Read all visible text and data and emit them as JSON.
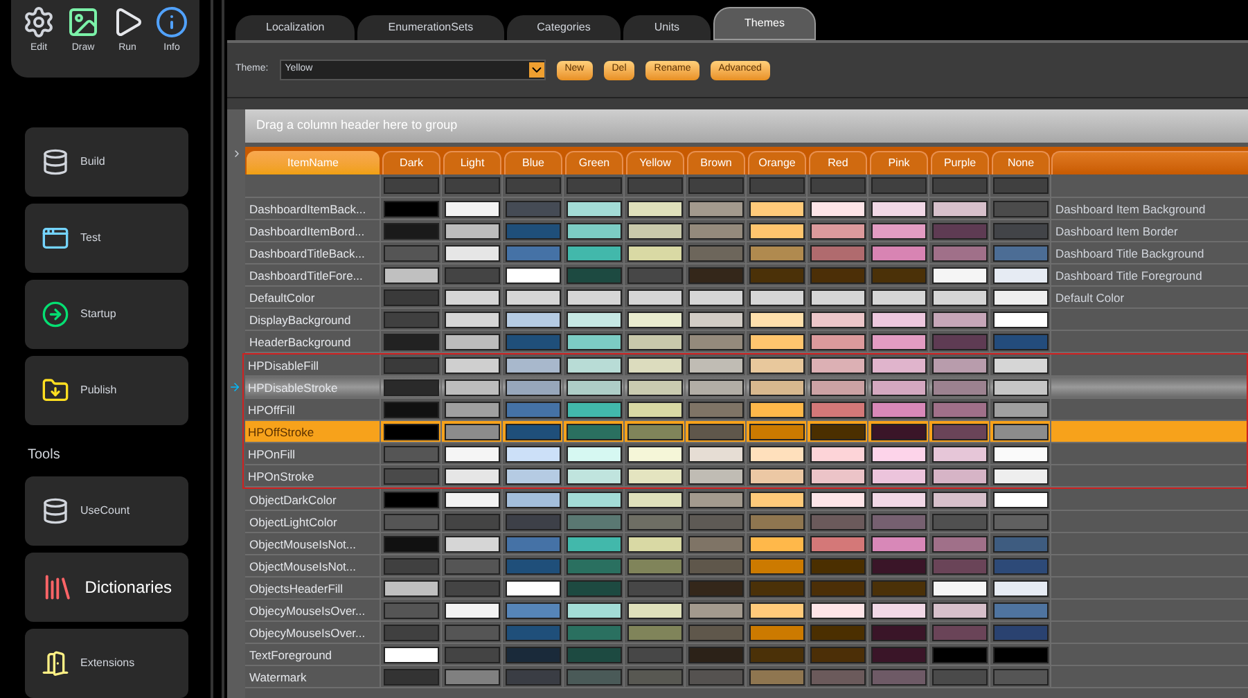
{
  "toolbar": [
    {
      "label": "Edit",
      "kind": "gear"
    },
    {
      "label": "Draw",
      "kind": "picture"
    },
    {
      "label": "Run",
      "kind": "play"
    },
    {
      "label": "Info",
      "kind": "info"
    }
  ],
  "sidebar": {
    "items": [
      {
        "label": "Build",
        "kind": "database",
        "large": false
      },
      {
        "label": "Test",
        "kind": "window",
        "large": false
      },
      {
        "label": "Startup",
        "kind": "arrow",
        "large": false
      },
      {
        "label": "Publish",
        "kind": "folder",
        "large": false
      }
    ],
    "section_title": "Tools",
    "tools": [
      {
        "label": "UseCount",
        "kind": "database",
        "large": false
      },
      {
        "label": "Dictionaries",
        "kind": "books",
        "large": true
      },
      {
        "label": "Extensions",
        "kind": "door",
        "large": false
      }
    ]
  },
  "tabs": [
    {
      "label": "Localization",
      "selected": false
    },
    {
      "label": "EnumerationSets",
      "selected": false
    },
    {
      "label": "Categories",
      "selected": false
    },
    {
      "label": "Units",
      "selected": false
    },
    {
      "label": "Themes",
      "selected": true
    }
  ],
  "theme_bar": {
    "label": "Theme:",
    "value": "Yellow",
    "buttons": [
      "New",
      "Del",
      "Rename",
      "Advanced"
    ]
  },
  "group_hint": "Drag a column header here to group",
  "table": {
    "columns": [
      "ItemName",
      "Dark",
      "Light",
      "Blue",
      "Green",
      "Yellow",
      "Brown",
      "Orange",
      "Red",
      "Pink",
      "Purple",
      "None"
    ],
    "rows": [
      {
        "name": "DashboardItemBack...",
        "description": "Dashboard Item Background",
        "selected": false,
        "hovered": false,
        "framed": false,
        "swatches": [
          {
            "color": "#000000"
          },
          {
            "color": "#f2f2f2"
          },
          {
            "color": "#454b55"
          },
          {
            "color": "#a3dcd6"
          },
          {
            "color": "#dfe0bb"
          },
          {
            "color": "#a39a8e"
          },
          {
            "color": "#ffca7a"
          },
          {
            "color": "#fde4e7"
          },
          {
            "color": "#f1d8e6"
          },
          {
            "color": "#d7c0cb"
          },
          {
            "color": "#4b4b4b"
          }
        ]
      },
      {
        "name": "DashboardItemBord...",
        "description": "Dashboard Item Border",
        "selected": false,
        "hovered": false,
        "framed": false,
        "swatches": [
          {
            "color": "#1a1a1a"
          },
          {
            "color": "#bdbdbd"
          },
          {
            "color": "#1f4f7a"
          },
          {
            "color": "#7cccc4"
          },
          {
            "color": "#c9c9ab"
          },
          {
            "color": "#948a7c"
          },
          {
            "color": "#ffc56e"
          },
          {
            "color": "#dc9a9c"
          },
          {
            "color": "#e39cc3"
          },
          {
            "color": "#5e3b53"
          },
          {
            "color": "#424448"
          }
        ]
      },
      {
        "name": "DashboardTitleBack...",
        "description": "Dashboard Title Background",
        "selected": false,
        "hovered": false,
        "framed": false,
        "swatches": [
          {
            "color": "#555555"
          },
          {
            "color": "#e6e6e6"
          },
          {
            "color": "#4572a6"
          },
          {
            "color": "#42b8ab"
          },
          {
            "color": "#d9d9a4"
          },
          {
            "color": "#6d665b"
          },
          {
            "color": "#b08a4f"
          },
          {
            "color": "#b06b6e"
          },
          {
            "color": "#d884b3"
          },
          {
            "color": "#a07089"
          },
          {
            "color": "#4c6d95"
          }
        ]
      },
      {
        "name": "DashboardTitleFore...",
        "description": "Dashboard Title Foreground",
        "selected": false,
        "hovered": false,
        "framed": false,
        "swatches": [
          {
            "color": "#c0c0c0"
          },
          {
            "color": "#444444"
          },
          {
            "color": "#ffffff"
          },
          {
            "color": "#1d4a41"
          },
          {
            "color": "#474747"
          },
          {
            "color": "#34271a"
          },
          {
            "color": "#4b3108"
          },
          {
            "color": "#4c2f07"
          },
          {
            "color": "#4b3108"
          },
          {
            "color": "#f5f5f5"
          },
          {
            "color": "#e6ebf3"
          }
        ]
      },
      {
        "name": "DefaultColor",
        "description": "Default Color",
        "selected": false,
        "hovered": false,
        "framed": false,
        "swatches": [
          {
            "color": "#3a3a3a"
          },
          {
            "color": "#d6d6d6"
          },
          {
            "color": "#d6d6d6"
          },
          {
            "color": "#d6d6d6"
          },
          {
            "color": "#d6d6d6"
          },
          {
            "color": "#d6d6d6"
          },
          {
            "color": "#d6d6d6"
          },
          {
            "color": "#d6d6d6"
          },
          {
            "color": "#d6d6d6"
          },
          {
            "color": "#d6d6d6"
          },
          {
            "color": "#eeeeee"
          }
        ]
      },
      {
        "name": "DisplayBackground",
        "selected": false,
        "hovered": false,
        "framed": false,
        "swatches": [
          {
            "color": "#404040"
          },
          {
            "color": "#d6d6d6"
          },
          {
            "color": "#b5cbe3"
          },
          {
            "color": "#c6e8e4"
          },
          {
            "color": "#eaeccf"
          },
          {
            "color": "#d2ccc5"
          },
          {
            "color": "#ffe0ac"
          },
          {
            "color": "#ecc6c9"
          },
          {
            "color": "#edc7de"
          },
          {
            "color": "#c6a6b8"
          },
          {
            "color": "#ffffff"
          }
        ]
      },
      {
        "name": "HeaderBackground",
        "selected": false,
        "hovered": false,
        "framed": false,
        "swatches": [
          {
            "color": "#222222"
          },
          {
            "color": "#bdbdbd"
          },
          {
            "color": "#1f4f7a"
          },
          {
            "color": "#7cccc4"
          },
          {
            "color": "#c9c9ab"
          },
          {
            "color": "#948a7c"
          },
          {
            "color": "#ffc56e"
          },
          {
            "color": "#dc9a9c"
          },
          {
            "color": "#e39cc3"
          },
          {
            "color": "#5e3b53"
          },
          {
            "color": "#234c7c"
          }
        ]
      },
      {
        "name": "HPDisableFill",
        "selected": false,
        "hovered": false,
        "framed": true,
        "swatches": [
          {
            "color": "#3a3a3a"
          },
          {
            "color": "#cfcfcf"
          },
          {
            "color": "#a8b8cc"
          },
          {
            "color": "#b8dcd6"
          },
          {
            "color": "#dcdcbe"
          },
          {
            "color": "#c0bcb4"
          },
          {
            "color": "#e8c89c"
          },
          {
            "color": "#dcb0b4"
          },
          {
            "color": "#e0b4cc"
          },
          {
            "color": "#b89cac"
          },
          {
            "color": "#d6d6d6"
          }
        ]
      },
      {
        "name": "HPDisableStroke",
        "selected": false,
        "hovered": true,
        "framed": true,
        "swatches": [
          {
            "color": "#2a2a2a"
          },
          {
            "color": "#bdbdbd"
          },
          {
            "color": "#97a7bb"
          },
          {
            "color": "#aecdc7"
          },
          {
            "color": "#cacbb0"
          },
          {
            "color": "#b2aea6"
          },
          {
            "color": "#d8b88e"
          },
          {
            "color": "#cca2a4"
          },
          {
            "color": "#d4a8c0"
          },
          {
            "color": "#9c8290"
          },
          {
            "color": "#c6c6c6"
          }
        ]
      },
      {
        "name": "HPOffFill",
        "selected": false,
        "hovered": false,
        "framed": true,
        "swatches": [
          {
            "color": "#111111"
          },
          {
            "color": "#a0a0a0"
          },
          {
            "color": "#4572a6"
          },
          {
            "color": "#42b8ab"
          },
          {
            "color": "#d9d9a4"
          },
          {
            "color": "#7f7466"
          },
          {
            "color": "#ffb84a"
          },
          {
            "color": "#d47878"
          },
          {
            "color": "#d888b8"
          },
          {
            "color": "#a07089"
          },
          {
            "color": "#a0a0a0"
          }
        ]
      },
      {
        "name": "HPOffStroke",
        "selected": true,
        "hovered": false,
        "framed": true,
        "swatches": [
          {
            "color": "#000000"
          },
          {
            "color": "#8c8c8c"
          },
          {
            "color": "#1f4f7a"
          },
          {
            "color": "#2a7060"
          },
          {
            "color": "#80845a"
          },
          {
            "color": "#5f574b"
          },
          {
            "color": "#cc7a00"
          },
          {
            "color": "#4b2f00"
          },
          {
            "color": "#3a1528"
          },
          {
            "color": "#6a4458"
          },
          {
            "color": "#8c8c8c"
          }
        ]
      },
      {
        "name": "HPOnFill",
        "selected": false,
        "hovered": false,
        "framed": true,
        "swatches": [
          {
            "color": "#555555"
          },
          {
            "color": "#f5f5f5"
          },
          {
            "color": "#cce0f8"
          },
          {
            "color": "#d6f8f2"
          },
          {
            "color": "#f5f6d8"
          },
          {
            "color": "#e6ddd4"
          },
          {
            "color": "#ffe0bc"
          },
          {
            "color": "#fdd4d8"
          },
          {
            "color": "#fdd4ea"
          },
          {
            "color": "#e6c6d8"
          },
          {
            "color": "#fafafa"
          }
        ]
      },
      {
        "name": "HPOnStroke",
        "selected": false,
        "hovered": false,
        "framed": true,
        "swatches": [
          {
            "color": "#4a4a4a"
          },
          {
            "color": "#e6e6e6"
          },
          {
            "color": "#b5cbe3"
          },
          {
            "color": "#c0e4de"
          },
          {
            "color": "#e4e4c0"
          },
          {
            "color": "#c0bcb4"
          },
          {
            "color": "#ecc8a4"
          },
          {
            "color": "#ecc4c8"
          },
          {
            "color": "#ecc4dc"
          },
          {
            "color": "#d6b4c6"
          },
          {
            "color": "#eeeeee"
          }
        ]
      },
      {
        "name": "ObjectDarkColor",
        "selected": false,
        "hovered": false,
        "framed": false,
        "swatches": [
          {
            "color": "#000000"
          },
          {
            "color": "#f2f2f2"
          },
          {
            "color": "#a3bedb"
          },
          {
            "color": "#a3dcd6"
          },
          {
            "color": "#dfe0bb"
          },
          {
            "color": "#a39a8e"
          },
          {
            "color": "#ffca7a"
          },
          {
            "color": "#fde4e7"
          },
          {
            "color": "#f1d8e6"
          },
          {
            "color": "#d7c0cb"
          },
          {
            "color": "#ffffff"
          }
        ]
      },
      {
        "name": "ObjectLightColor",
        "selected": false,
        "hovered": false,
        "framed": false,
        "swatches": [
          {
            "color": "#555555"
          },
          {
            "color": "#444444"
          },
          {
            "color": "#3d4048"
          },
          {
            "color": "#5a7872"
          },
          {
            "color": "#6e6e64"
          },
          {
            "color": "#5e5a55"
          },
          {
            "color": "#8f7650"
          },
          {
            "color": "#6b5a5b"
          },
          {
            "color": "#766070"
          },
          {
            "color": "#505050"
          },
          {
            "color": "#606060"
          }
        ]
      },
      {
        "name": "ObjectMouseIsNot...",
        "selected": false,
        "hovered": false,
        "framed": false,
        "swatches": [
          {
            "color": "#111111"
          },
          {
            "color": "#d6d6d6"
          },
          {
            "color": "#4572a6"
          },
          {
            "color": "#42b8ab"
          },
          {
            "color": "#d9d9a4"
          },
          {
            "color": "#7f7466"
          },
          {
            "color": "#ffb84a"
          },
          {
            "color": "#d47878"
          },
          {
            "color": "#d888b8"
          },
          {
            "color": "#a07089"
          },
          {
            "color": "#3e5c80"
          }
        ]
      },
      {
        "name": "ObjectMouseIsNot...",
        "selected": false,
        "hovered": false,
        "framed": false,
        "swatches": [
          {
            "color": "#404040"
          },
          {
            "color": "#555555"
          },
          {
            "color": "#1f4f7a"
          },
          {
            "color": "#2a7060"
          },
          {
            "color": "#80845a"
          },
          {
            "color": "#5f574b"
          },
          {
            "color": "#cc7a00"
          },
          {
            "color": "#4b2f00"
          },
          {
            "color": "#3a1528"
          },
          {
            "color": "#6a4458"
          },
          {
            "color": "#2d4a78"
          }
        ]
      },
      {
        "name": "ObjectsHeaderFill",
        "selected": false,
        "hovered": false,
        "framed": false,
        "swatches": [
          {
            "color": "#c0c0c0"
          },
          {
            "color": "#444444"
          },
          {
            "color": "#ffffff"
          },
          {
            "color": "#1d4a41"
          },
          {
            "color": "#474747"
          },
          {
            "color": "#34271a"
          },
          {
            "color": "#4b3108"
          },
          {
            "color": "#4c2f07"
          },
          {
            "color": "#4b3108"
          },
          {
            "color": "#f5f5f5"
          },
          {
            "color": "#e6ebf3"
          }
        ]
      },
      {
        "name": "ObjecyMouseIsOver...",
        "selected": false,
        "hovered": false,
        "framed": false,
        "swatches": [
          {
            "color": "#555555"
          },
          {
            "color": "#f2f2f2"
          },
          {
            "color": "#5685b8"
          },
          {
            "color": "#a3dcd6"
          },
          {
            "color": "#dfe0bb"
          },
          {
            "color": "#a39a8e"
          },
          {
            "color": "#ffca7a"
          },
          {
            "color": "#fde4e7"
          },
          {
            "color": "#f1d8e6"
          },
          {
            "color": "#d7c0cb"
          },
          {
            "color": "#4f74a0"
          }
        ]
      },
      {
        "name": "ObjecyMouseIsOver...",
        "selected": false,
        "hovered": false,
        "framed": false,
        "swatches": [
          {
            "color": "#404040"
          },
          {
            "color": "#555555"
          },
          {
            "color": "#1f4f7a"
          },
          {
            "color": "#2a7060"
          },
          {
            "color": "#80845a"
          },
          {
            "color": "#5f574b"
          },
          {
            "color": "#cc7a00"
          },
          {
            "color": "#4b2f00"
          },
          {
            "color": "#3a1528"
          },
          {
            "color": "#6a4458"
          },
          {
            "color": "#2a4270"
          }
        ]
      },
      {
        "name": "TextForeground",
        "selected": false,
        "hovered": false,
        "framed": false,
        "swatches": [
          {
            "color": "#ffffff"
          },
          {
            "color": "#444444"
          },
          {
            "color": "#1a2a3a"
          },
          {
            "color": "#1d4a41"
          },
          {
            "color": "#474747"
          },
          {
            "color": "#2c2218"
          },
          {
            "color": "#4b3108"
          },
          {
            "color": "#4c2f07"
          },
          {
            "color": "#3a1528"
          },
          {
            "color": "#000000"
          },
          {
            "color": "#000000"
          }
        ]
      },
      {
        "name": "Watermark",
        "selected": false,
        "hovered": false,
        "framed": false,
        "swatches": [
          {
            "color": "#333333"
          },
          {
            "color": "#808080"
          },
          {
            "color": "#3a3d44"
          },
          {
            "color": "#4a5a58"
          },
          {
            "color": "#585852"
          },
          {
            "color": "#555250"
          },
          {
            "color": "#8f7650"
          },
          {
            "color": "#6b5a5b"
          },
          {
            "color": "#6e5a66"
          },
          {
            "color": "#4a4a4a"
          },
          {
            "color": "#555555"
          }
        ]
      }
    ]
  }
}
